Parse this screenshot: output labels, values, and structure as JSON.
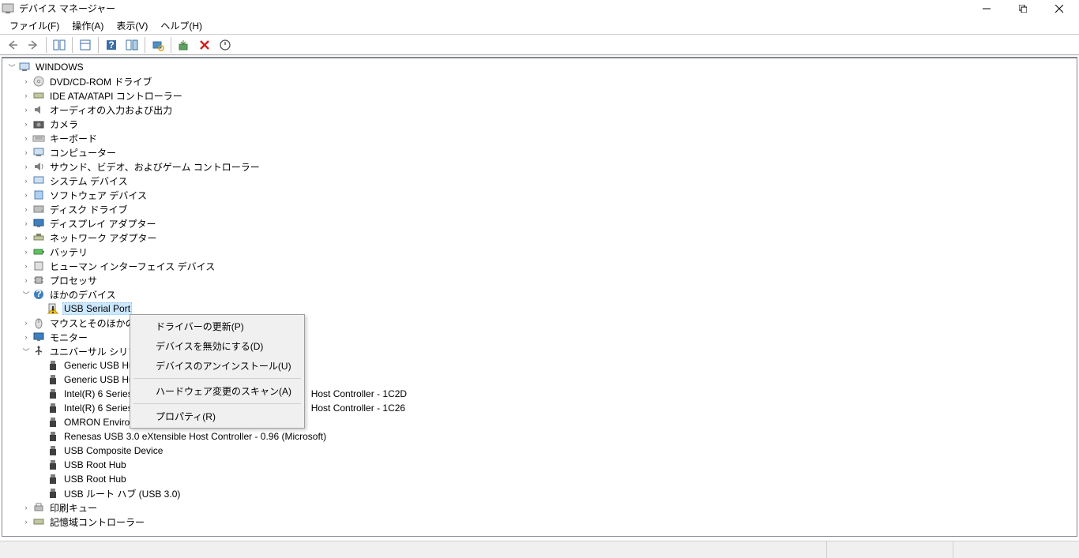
{
  "window": {
    "title": "デバイス マネージャー"
  },
  "menu": {
    "file": "ファイル(F)",
    "action": "操作(A)",
    "view": "表示(V)",
    "help": "ヘルプ(H)"
  },
  "tree": {
    "root": "WINDOWS",
    "categories": [
      {
        "label": "DVD/CD-ROM ドライブ",
        "icon": "dvd"
      },
      {
        "label": "IDE ATA/ATAPI コントローラー",
        "icon": "ide"
      },
      {
        "label": "オーディオの入力および出力",
        "icon": "audio"
      },
      {
        "label": "カメラ",
        "icon": "camera"
      },
      {
        "label": "キーボード",
        "icon": "keyboard"
      },
      {
        "label": "コンピューター",
        "icon": "computer"
      },
      {
        "label": "サウンド、ビデオ、およびゲーム コントローラー",
        "icon": "sound"
      },
      {
        "label": "システム デバイス",
        "icon": "system"
      },
      {
        "label": "ソフトウェア デバイス",
        "icon": "software"
      },
      {
        "label": "ディスク ドライブ",
        "icon": "disk"
      },
      {
        "label": "ディスプレイ アダプター",
        "icon": "display"
      },
      {
        "label": "ネットワーク アダプター",
        "icon": "network"
      },
      {
        "label": "バッテリ",
        "icon": "battery"
      },
      {
        "label": "ヒューマン インターフェイス デバイス",
        "icon": "hid"
      },
      {
        "label": "プロセッサ",
        "icon": "cpu"
      },
      {
        "label": "ほかのデバイス",
        "icon": "other",
        "expanded": true,
        "children": [
          {
            "label": "USB Serial Port",
            "warning": true,
            "selected": true
          }
        ]
      },
      {
        "label": "マウスとそのほかのポインティング デバイス",
        "icon": "mouse",
        "truncated": "マウスとそのほかのポ"
      },
      {
        "label": "モニター",
        "icon": "monitor"
      },
      {
        "label": "ユニバーサル シリアル バス コントローラー",
        "icon": "usb",
        "expanded": true,
        "truncated": "ユニバーサル シリアル",
        "children": [
          {
            "label": "Generic USB Hub",
            "truncated": "Generic USB Hu"
          },
          {
            "label": "Generic USB Hub",
            "truncated": "Generic USB Hu"
          },
          {
            "label": "Intel(R) 6 Series/C200 Series Chipset Family USB Enhanced Host Controller - 1C2D",
            "truncated_left": "Intel(R) 6 Series",
            "truncated_right": "Host Controller - 1C2D"
          },
          {
            "label": "Intel(R) 6 Series/C200 Series Chipset Family USB Enhanced Host Controller - 1C26",
            "truncated_left": "Intel(R) 6 Series",
            "truncated_right": "Host Controller - 1C26"
          },
          {
            "label": "OMRON Environment Sensor 2JCIE-BU01"
          },
          {
            "label": "Renesas USB 3.0 eXtensible Host Controller - 0.96 (Microsoft)"
          },
          {
            "label": "USB Composite Device"
          },
          {
            "label": "USB Root Hub"
          },
          {
            "label": "USB Root Hub"
          },
          {
            "label": "USB ルート ハブ (USB 3.0)"
          }
        ]
      },
      {
        "label": "印刷キュー",
        "icon": "printer"
      },
      {
        "label": "記憶域コントローラー",
        "icon": "storage"
      }
    ]
  },
  "context_menu": {
    "update_driver": "ドライバーの更新(P)",
    "disable_device": "デバイスを無効にする(D)",
    "uninstall_device": "デバイスのアンインストール(U)",
    "scan_hardware": "ハードウェア変更のスキャン(A)",
    "properties": "プロパティ(R)"
  }
}
